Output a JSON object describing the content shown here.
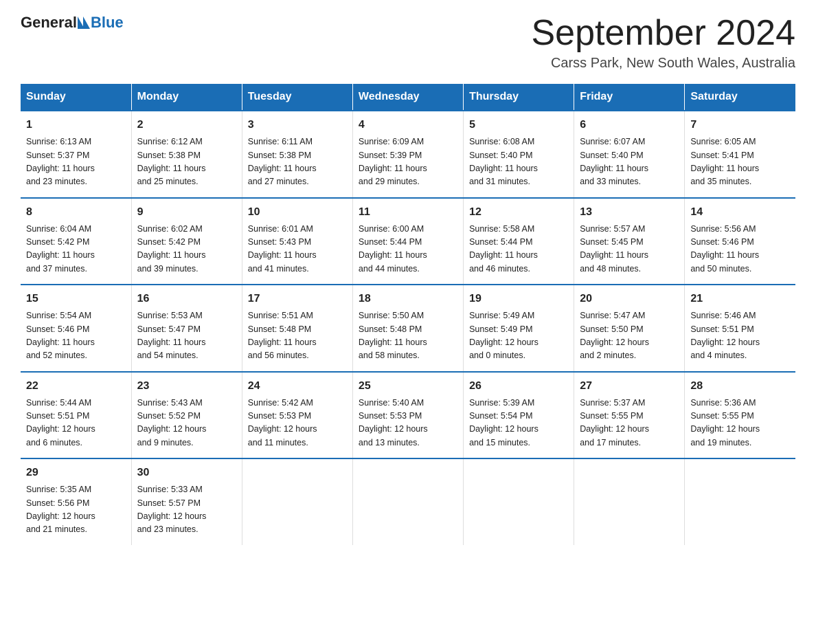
{
  "header": {
    "logo_general": "General",
    "logo_blue": "Blue",
    "month_title": "September 2024",
    "location": "Carss Park, New South Wales, Australia"
  },
  "days_of_week": [
    "Sunday",
    "Monday",
    "Tuesday",
    "Wednesday",
    "Thursday",
    "Friday",
    "Saturday"
  ],
  "weeks": [
    [
      {
        "num": "1",
        "sunrise": "6:13 AM",
        "sunset": "5:37 PM",
        "daylight": "11 hours and 23 minutes."
      },
      {
        "num": "2",
        "sunrise": "6:12 AM",
        "sunset": "5:38 PM",
        "daylight": "11 hours and 25 minutes."
      },
      {
        "num": "3",
        "sunrise": "6:11 AM",
        "sunset": "5:38 PM",
        "daylight": "11 hours and 27 minutes."
      },
      {
        "num": "4",
        "sunrise": "6:09 AM",
        "sunset": "5:39 PM",
        "daylight": "11 hours and 29 minutes."
      },
      {
        "num": "5",
        "sunrise": "6:08 AM",
        "sunset": "5:40 PM",
        "daylight": "11 hours and 31 minutes."
      },
      {
        "num": "6",
        "sunrise": "6:07 AM",
        "sunset": "5:40 PM",
        "daylight": "11 hours and 33 minutes."
      },
      {
        "num": "7",
        "sunrise": "6:05 AM",
        "sunset": "5:41 PM",
        "daylight": "11 hours and 35 minutes."
      }
    ],
    [
      {
        "num": "8",
        "sunrise": "6:04 AM",
        "sunset": "5:42 PM",
        "daylight": "11 hours and 37 minutes."
      },
      {
        "num": "9",
        "sunrise": "6:02 AM",
        "sunset": "5:42 PM",
        "daylight": "11 hours and 39 minutes."
      },
      {
        "num": "10",
        "sunrise": "6:01 AM",
        "sunset": "5:43 PM",
        "daylight": "11 hours and 41 minutes."
      },
      {
        "num": "11",
        "sunrise": "6:00 AM",
        "sunset": "5:44 PM",
        "daylight": "11 hours and 44 minutes."
      },
      {
        "num": "12",
        "sunrise": "5:58 AM",
        "sunset": "5:44 PM",
        "daylight": "11 hours and 46 minutes."
      },
      {
        "num": "13",
        "sunrise": "5:57 AM",
        "sunset": "5:45 PM",
        "daylight": "11 hours and 48 minutes."
      },
      {
        "num": "14",
        "sunrise": "5:56 AM",
        "sunset": "5:46 PM",
        "daylight": "11 hours and 50 minutes."
      }
    ],
    [
      {
        "num": "15",
        "sunrise": "5:54 AM",
        "sunset": "5:46 PM",
        "daylight": "11 hours and 52 minutes."
      },
      {
        "num": "16",
        "sunrise": "5:53 AM",
        "sunset": "5:47 PM",
        "daylight": "11 hours and 54 minutes."
      },
      {
        "num": "17",
        "sunrise": "5:51 AM",
        "sunset": "5:48 PM",
        "daylight": "11 hours and 56 minutes."
      },
      {
        "num": "18",
        "sunrise": "5:50 AM",
        "sunset": "5:48 PM",
        "daylight": "11 hours and 58 minutes."
      },
      {
        "num": "19",
        "sunrise": "5:49 AM",
        "sunset": "5:49 PM",
        "daylight": "12 hours and 0 minutes."
      },
      {
        "num": "20",
        "sunrise": "5:47 AM",
        "sunset": "5:50 PM",
        "daylight": "12 hours and 2 minutes."
      },
      {
        "num": "21",
        "sunrise": "5:46 AM",
        "sunset": "5:51 PM",
        "daylight": "12 hours and 4 minutes."
      }
    ],
    [
      {
        "num": "22",
        "sunrise": "5:44 AM",
        "sunset": "5:51 PM",
        "daylight": "12 hours and 6 minutes."
      },
      {
        "num": "23",
        "sunrise": "5:43 AM",
        "sunset": "5:52 PM",
        "daylight": "12 hours and 9 minutes."
      },
      {
        "num": "24",
        "sunrise": "5:42 AM",
        "sunset": "5:53 PM",
        "daylight": "12 hours and 11 minutes."
      },
      {
        "num": "25",
        "sunrise": "5:40 AM",
        "sunset": "5:53 PM",
        "daylight": "12 hours and 13 minutes."
      },
      {
        "num": "26",
        "sunrise": "5:39 AM",
        "sunset": "5:54 PM",
        "daylight": "12 hours and 15 minutes."
      },
      {
        "num": "27",
        "sunrise": "5:37 AM",
        "sunset": "5:55 PM",
        "daylight": "12 hours and 17 minutes."
      },
      {
        "num": "28",
        "sunrise": "5:36 AM",
        "sunset": "5:55 PM",
        "daylight": "12 hours and 19 minutes."
      }
    ],
    [
      {
        "num": "29",
        "sunrise": "5:35 AM",
        "sunset": "5:56 PM",
        "daylight": "12 hours and 21 minutes."
      },
      {
        "num": "30",
        "sunrise": "5:33 AM",
        "sunset": "5:57 PM",
        "daylight": "12 hours and 23 minutes."
      },
      null,
      null,
      null,
      null,
      null
    ]
  ],
  "labels": {
    "sunrise": "Sunrise:",
    "sunset": "Sunset:",
    "daylight": "Daylight:"
  }
}
